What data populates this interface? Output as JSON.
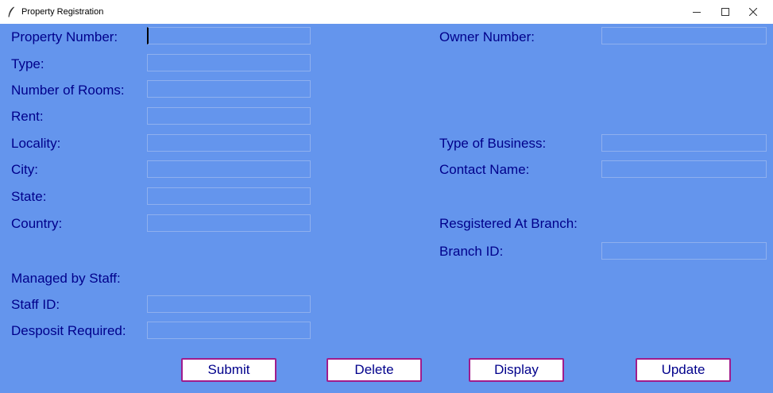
{
  "window": {
    "title": "Property Registration",
    "background_color": "#6495ed",
    "label_color": "#00008b",
    "button_border_color": "#a01c8c"
  },
  "title_buttons": {
    "minimize_icon": "minimize-icon",
    "maximize_icon": "maximize-icon",
    "close_icon": "close-icon"
  },
  "left_form": {
    "property_number": {
      "label": "Property Number:",
      "value": ""
    },
    "type": {
      "label": "Type:",
      "value": ""
    },
    "number_of_rooms": {
      "label": "Number of Rooms:",
      "value": ""
    },
    "rent": {
      "label": "Rent:",
      "value": ""
    },
    "locality": {
      "label": "Locality:",
      "value": ""
    },
    "city": {
      "label": "City:",
      "value": ""
    },
    "state": {
      "label": "State:",
      "value": ""
    },
    "country": {
      "label": "Country:",
      "value": ""
    },
    "managed_by_staff": {
      "label": "Managed by Staff:"
    },
    "staff_id": {
      "label": "Staff ID:",
      "value": ""
    },
    "deposit_required": {
      "label": "Desposit Required:",
      "value": ""
    }
  },
  "right_form": {
    "owner_number": {
      "label": "Owner Number:",
      "value": ""
    },
    "type_of_business": {
      "label": "Type of Business:",
      "value": ""
    },
    "contact_name": {
      "label": "Contact Name:",
      "value": ""
    },
    "registered_at_branch": {
      "label": "Resgistered At Branch:"
    },
    "branch_id": {
      "label": "Branch ID:",
      "value": ""
    }
  },
  "buttons": {
    "submit": "Submit",
    "delete": "Delete",
    "display": "Display",
    "update": "Update"
  }
}
